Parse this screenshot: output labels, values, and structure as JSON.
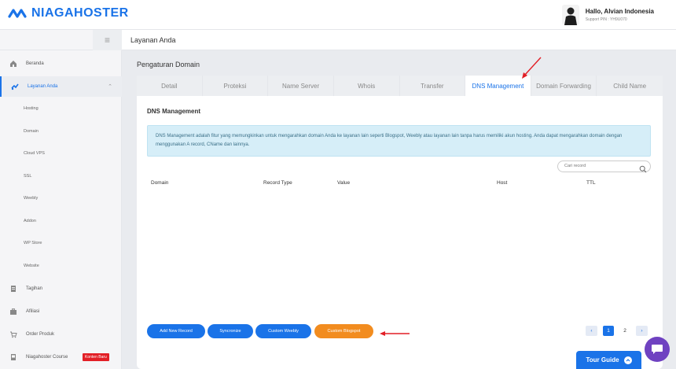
{
  "brand": {
    "name": "NIAGAHOSTER",
    "color": "#1a73e8"
  },
  "user": {
    "greeting": "Hallo, Alvian Indonesia",
    "support_pin": "Support PIN : YH9U070"
  },
  "sidebar": {
    "menu_icon": "hamburger-icon",
    "items": [
      {
        "label": "Beranda",
        "icon": "home-icon"
      },
      {
        "label": "Layanan Anda",
        "icon": "services-icon",
        "active": true
      },
      {
        "label": "Tagihan",
        "icon": "invoice-icon"
      },
      {
        "label": "Afiliasi",
        "icon": "briefcase-icon"
      },
      {
        "label": "Order Produk",
        "icon": "cart-icon"
      },
      {
        "label": "Niagahoster Course",
        "icon": "course-icon",
        "badge": "Konten Baru"
      }
    ],
    "subitems": [
      "Hosting",
      "Domain",
      "Cloud VPS",
      "SSL",
      "Weebly",
      "Addon",
      "WP Store",
      "Website"
    ]
  },
  "breadcrumb": {
    "title": "Layanan Anda"
  },
  "main": {
    "section_title": "Pengaturan Domain",
    "tabs": [
      {
        "label": "Detail"
      },
      {
        "label": "Proteksi"
      },
      {
        "label": "Name Server"
      },
      {
        "label": "Whois"
      },
      {
        "label": "Transfer"
      },
      {
        "label": "DNS Management",
        "active": true
      },
      {
        "label": "Domain Forwarding"
      },
      {
        "label": "Child Name"
      }
    ],
    "panel_title": "DNS Management",
    "info_text": "DNS Management adalah fitur yang memungkinkan untuk mengarahkan domain Anda ke layanan lain seperti Blogspot, Weebly atau layanan lain tanpa harus memiliki akun hosting. Anda dapat mengarahkan domain dengan menggunakan A record, CName dan lainnya.",
    "search": {
      "placeholder": "Cari record",
      "icon": "search-icon"
    },
    "table": {
      "columns": [
        "Domain",
        "Record Type",
        "Value",
        "Host",
        "TTL"
      ]
    },
    "buttons": {
      "add_record": "Add New Record",
      "syncronize": "Syncronize",
      "custom_weebly": "Custom Weebly",
      "custom_blogspot": "Custom Blogspot"
    },
    "pagination": {
      "pages": [
        "1",
        "2"
      ],
      "current": "1",
      "prev": "‹",
      "next": "›"
    }
  },
  "tour_guide": "Tour Guide",
  "colors": {
    "accent": "#1a73e8",
    "orange": "#f28c1f",
    "annotation": "#e21f26",
    "chat": "#6f42c1"
  }
}
